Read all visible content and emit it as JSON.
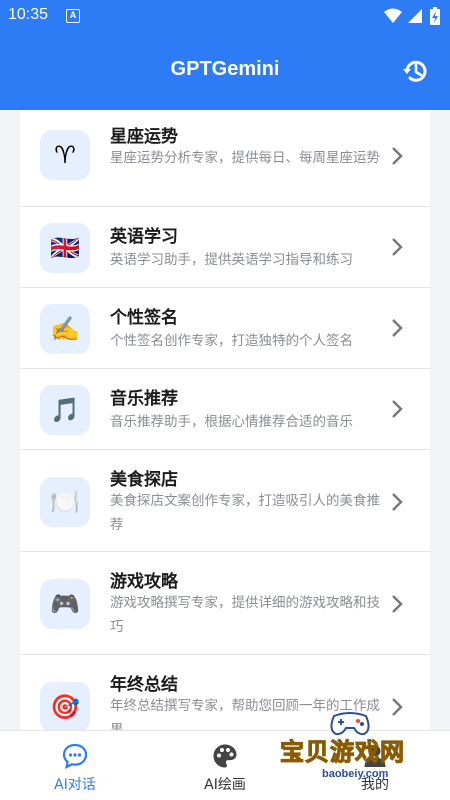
{
  "status_bar": {
    "time": "10:35",
    "notification_letter": "A"
  },
  "app_bar": {
    "title": "GPTGemini",
    "history_icon": "history-icon"
  },
  "items": [
    {
      "icon": "♈",
      "title": "星座运势",
      "desc": "星座运势分析专家，提供每日、每周星座运势"
    },
    {
      "icon": "🇬🇧",
      "title": "英语学习",
      "desc": "英语学习助手，提供英语学习指导和练习"
    },
    {
      "icon": "✍️",
      "title": "个性签名",
      "desc": "个性签名创作专家，打造独特的个人签名"
    },
    {
      "icon": "🎵",
      "title": "音乐推荐",
      "desc": "音乐推荐助手，根据心情推荐合适的音乐"
    },
    {
      "icon": "🍽️",
      "title": "美食探店",
      "desc": "美食探店文案创作专家，打造吸引人的美食推荐"
    },
    {
      "icon": "🎮",
      "title": "游戏攻略",
      "desc": "游戏攻略撰写专家，提供详细的游戏攻略和技巧"
    },
    {
      "icon": "🎯",
      "title": "年终总结",
      "desc": "年终总结撰写专家，帮助您回顾一年的工作成果"
    }
  ],
  "bottom_nav": {
    "tabs": [
      {
        "label": "AI对话",
        "icon": "chat-icon",
        "active": true
      },
      {
        "label": "AI绘画",
        "icon": "palette-icon",
        "active": false
      },
      {
        "label": "我的",
        "icon": "user-icon",
        "active": false
      }
    ]
  },
  "watermark": {
    "text": "宝贝游戏网",
    "url": "baobeiy.com"
  },
  "colors": {
    "primary": "#2d7cf6",
    "icon_bg": "#e5effd",
    "desc_text": "#8a8d92"
  }
}
